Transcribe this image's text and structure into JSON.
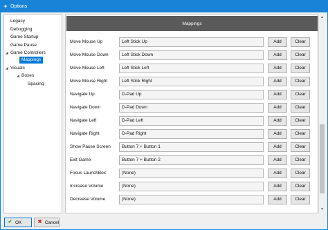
{
  "window": {
    "title": "Options",
    "accent_color": "#1883d7"
  },
  "sidebar": {
    "items": [
      {
        "label": "Legacy",
        "expanded": false
      },
      {
        "label": "Debugging",
        "expanded": false
      },
      {
        "label": "Game Startup",
        "expanded": false
      },
      {
        "label": "Game Pause",
        "expanded": false
      },
      {
        "label": "Game Controllers",
        "expanded": true
      },
      {
        "label": "Mappings",
        "selected": true
      },
      {
        "label": "Visuals",
        "expanded": true
      },
      {
        "label": "Boxes",
        "expanded": true
      },
      {
        "label": "Spacing"
      }
    ],
    "selected_color": "#0078d7"
  },
  "main": {
    "header": "Mappings",
    "add_label": "Add",
    "clear_label": "Clear",
    "rows": [
      {
        "label": "Move Mouse Up",
        "value": "Left Stick Up"
      },
      {
        "label": "Move Mouse Down",
        "value": "Left Stick Down"
      },
      {
        "label": "Move Mouse Left",
        "value": "Left Stick Left"
      },
      {
        "label": "Move Mouse Right",
        "value": "Left Stick Right"
      },
      {
        "label": "Navigate Up",
        "value": "D-Pad Up"
      },
      {
        "label": "Navigate Down",
        "value": "D-Pad Down"
      },
      {
        "label": "Navigate Left",
        "value": "D-Pad Left"
      },
      {
        "label": "Navigate Right",
        "value": "D-Pad Right"
      },
      {
        "label": "Show Pause Screen",
        "value": "Button 7 + Button 1"
      },
      {
        "label": "Exit Game",
        "value": "Button 7 + Button 2"
      },
      {
        "label": "Focus LaunchBox",
        "value": "(None)"
      },
      {
        "label": "Increase Volume",
        "value": "(None)"
      },
      {
        "label": "Decrease Volume",
        "value": "(None)"
      }
    ]
  },
  "footer": {
    "ok_label": "OK",
    "cancel_label": "Cancel"
  },
  "icons": {
    "app": "launchbox-icon",
    "ok": "checkmark-icon",
    "cancel": "x-icon",
    "scroll_up": "chevron-up-icon",
    "scroll_down": "chevron-down-icon",
    "tree_collapse": "chevron-collapse-icon"
  }
}
